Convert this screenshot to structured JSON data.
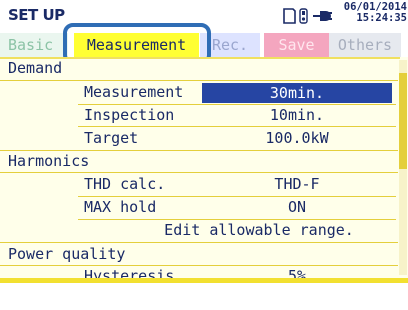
{
  "header": {
    "title": "SET UP",
    "date": "06/01/2014",
    "time": "15:24:35",
    "icons": [
      "sd-card-icon",
      "usb-icon",
      "ac-power-plug-icon"
    ]
  },
  "tabs": [
    {
      "label": "Basic",
      "state": "inactive"
    },
    {
      "label": "Measurement",
      "state": "selected"
    },
    {
      "label": "Rec.",
      "state": "inactive"
    },
    {
      "label": "Save",
      "state": "inactive"
    },
    {
      "label": "Others",
      "state": "inactive"
    }
  ],
  "sections": {
    "demand": {
      "title": "Demand",
      "rows": [
        {
          "label": "Measurement",
          "value": "30min."
        },
        {
          "label": "Inspection",
          "value": "10min."
        },
        {
          "label": "Target",
          "value": "100.0kW"
        }
      ]
    },
    "harmonics": {
      "title": "Harmonics",
      "rows": [
        {
          "label": "THD calc.",
          "value": "THD-F"
        },
        {
          "label": "MAX hold",
          "value": "ON"
        }
      ],
      "action": "Edit allowable range."
    },
    "power_quality": {
      "title": "Power quality",
      "rows": [
        {
          "label": "Hysteresis",
          "value": "5%"
        }
      ]
    }
  },
  "colors": {
    "selected_value_bg": "#2645a3",
    "active_tab": "#ffff33",
    "focus_ring": "#2f6db5",
    "text": "#1a2a66"
  }
}
